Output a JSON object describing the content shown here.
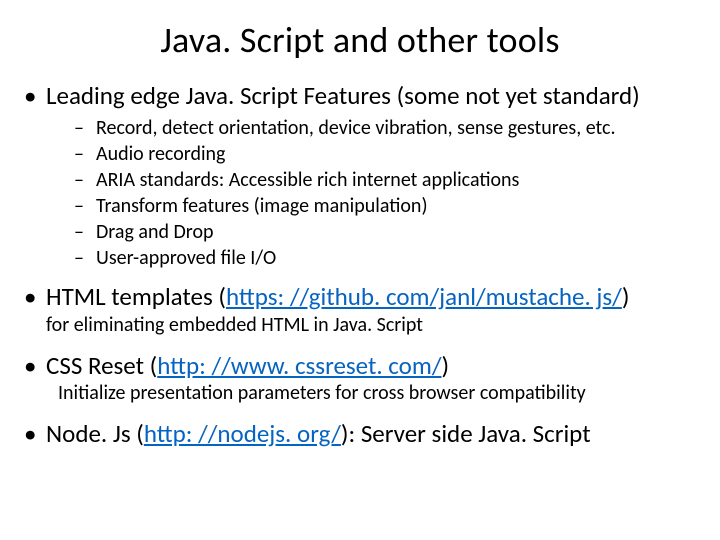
{
  "title": "Java. Script and other tools",
  "bullets": [
    {
      "text": "Leading edge Java. Script Features (some not yet standard)",
      "sub": [
        "Record, detect orientation, device vibration, sense gestures, etc.",
        "Audio recording",
        "ARIA standards: Accessible rich internet applications",
        "Transform features (image manipulation)",
        "Drag and Drop",
        "User-approved file I/O"
      ]
    },
    {
      "pre": "HTML templates (",
      "link": "https: //github. com/janl/mustache. js/",
      "post": ")",
      "note": "for eliminating embedded HTML in Java. Script",
      "note_indent": false
    },
    {
      "pre": "CSS Reset (",
      "link": "http: //www. cssreset. com/",
      "post": ")",
      "note": "Initialize presentation parameters for cross browser compatibility",
      "note_indent": true
    },
    {
      "pre": "Node. Js (",
      "link": "http: //nodejs. org/",
      "post": "): Server side Java. Script"
    }
  ]
}
